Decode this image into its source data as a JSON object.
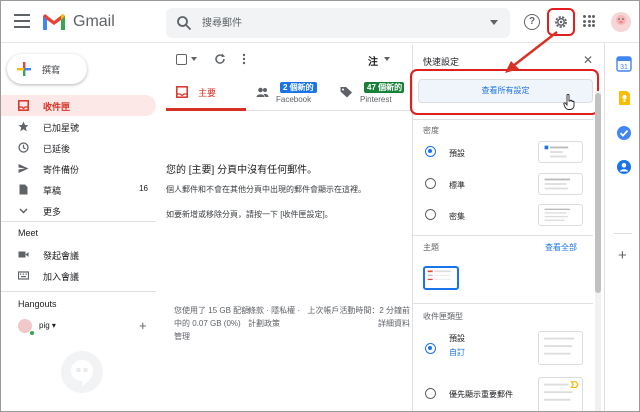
{
  "app": {
    "name": "Gmail"
  },
  "search": {
    "placeholder": "搜尋郵件"
  },
  "header": {
    "help_icon": "help-icon",
    "settings_icon": "gear-icon",
    "apps_icon": "apps-icon"
  },
  "compose": {
    "label": "撰寫"
  },
  "sidebar": {
    "items": [
      {
        "label": "收件匣",
        "icon": "inbox-icon",
        "active": true,
        "count": ""
      },
      {
        "label": "已加星號",
        "icon": "star-icon",
        "active": false,
        "count": ""
      },
      {
        "label": "已延後",
        "icon": "clock-icon",
        "active": false,
        "count": ""
      },
      {
        "label": "寄件備份",
        "icon": "send-icon",
        "active": false,
        "count": ""
      },
      {
        "label": "草稿",
        "icon": "draft-icon",
        "active": false,
        "count": "16"
      },
      {
        "label": "更多",
        "icon": "chevron-down-icon",
        "active": false,
        "count": ""
      }
    ],
    "meet": {
      "title": "Meet",
      "items": [
        {
          "label": "發起會議",
          "icon": "video-icon"
        },
        {
          "label": "加入會議",
          "icon": "keyboard-icon"
        }
      ]
    },
    "hangouts": {
      "title": "Hangouts",
      "user": "pig",
      "caret": "▾"
    }
  },
  "toolbar": {
    "lang_label": "注"
  },
  "tabs": [
    {
      "label": "主要",
      "badge": "",
      "sub": ""
    },
    {
      "label": "",
      "badge": "2 個新的",
      "sub": "Facebook",
      "badge_color": "#1a73e8"
    },
    {
      "label": "",
      "badge": "47 個新的",
      "sub": "Pinterest",
      "badge_color": "#188038"
    }
  ],
  "main": {
    "empty_title": "您的 [主要] 分頁中沒有任何郵件。",
    "empty_line1": "個人郵件和不會在其他分頁中出現的郵件會顯示在這裡。",
    "empty_line2": "如要新增或移除分頁，請按一下 [收件匣設定]。"
  },
  "footer": {
    "storage": "您使用了 15 GB 配額中的 0.07 GB (0%)",
    "manage": "管理",
    "policy": "條款 · 隱私權 · 計劃政策",
    "activity": "上次帳戶活動時間：2 分鐘前",
    "details": "詳細資料"
  },
  "quick_settings": {
    "title": "快速設定",
    "see_all": "查看所有設定",
    "density": {
      "title": "密度",
      "options": [
        {
          "label": "預設",
          "selected": true
        },
        {
          "label": "標準",
          "selected": false
        },
        {
          "label": "密集",
          "selected": false
        }
      ]
    },
    "theme": {
      "title": "主題",
      "view_all": "查看全部"
    },
    "inbox_type": {
      "title": "收件匣類型",
      "options": [
        {
          "label": "預設",
          "sublink": "自訂",
          "selected": true
        },
        {
          "label": "優先顯示重要郵件",
          "selected": false
        }
      ]
    }
  },
  "colors": {
    "accent_red": "#d93025",
    "highlight_red": "#e02020",
    "link_blue": "#1a73e8",
    "green": "#188038"
  }
}
